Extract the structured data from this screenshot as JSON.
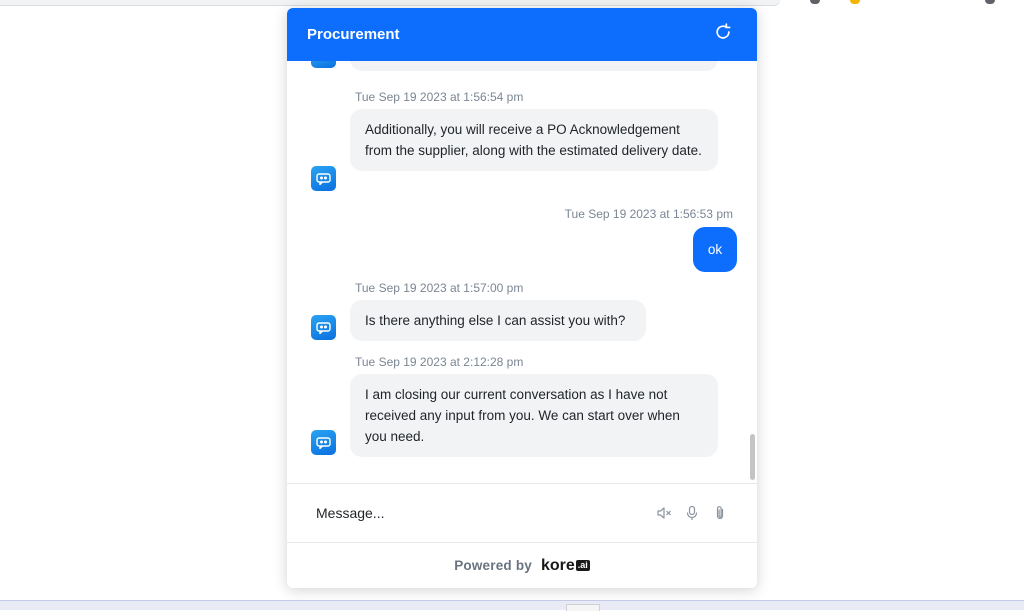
{
  "widget": {
    "title": "Procurement",
    "messages": [
      {
        "timestamp": "Tue Sep 19 2023 at 1:56:54 pm",
        "from": "bot",
        "text": "Additionally, you will receive a PO Acknowledgement from the supplier, along with the estimated delivery date."
      },
      {
        "timestamp": "Tue Sep 19 2023 at 1:56:53 pm",
        "from": "user",
        "text": "ok"
      },
      {
        "timestamp": "Tue Sep 19 2023 at 1:57:00 pm",
        "from": "bot",
        "text": "Is there anything else I can assist you with?"
      },
      {
        "timestamp": "Tue Sep 19 2023 at 2:12:28 pm",
        "from": "bot",
        "text": "I am closing our current conversation as I have not received any input from you. We can start over when you need."
      }
    ],
    "composer": {
      "placeholder": "Message..."
    },
    "footer": {
      "powered_by": "Powered by",
      "brand_name": "kore",
      "brand_suffix": ".ai"
    }
  },
  "icons": {
    "header": "refresh-icon",
    "avatar": "bot-avatar-icon",
    "composer": [
      "speaker-mute-icon",
      "microphone-icon",
      "paperclip-icon"
    ]
  },
  "colors": {
    "accent": "#0d6efd",
    "bot_bubble": "#f2f3f5",
    "timestamp": "#7b8694"
  }
}
